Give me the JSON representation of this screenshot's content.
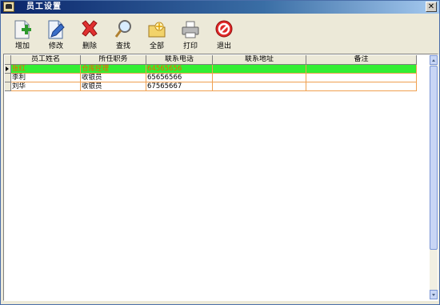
{
  "window": {
    "title": "员工设置",
    "close_label": "✕"
  },
  "toolbar": {
    "items": [
      {
        "label": "增加",
        "icon": "add-document-icon"
      },
      {
        "label": "修改",
        "icon": "edit-document-icon"
      },
      {
        "label": "删除",
        "icon": "delete-x-icon"
      },
      {
        "label": "查找",
        "icon": "magnifier-icon"
      },
      {
        "label": "全部",
        "icon": "folder-all-icon"
      },
      {
        "label": "打印",
        "icon": "printer-icon"
      },
      {
        "label": "退出",
        "icon": "exit-stop-icon"
      }
    ]
  },
  "grid": {
    "columns": [
      "员工姓名",
      "所任职务",
      "联系电话",
      "联系地址",
      "备注"
    ],
    "rows": [
      {
        "name": "张红",
        "role": "仓库经理",
        "phone": "64565656",
        "address": "",
        "note": ""
      },
      {
        "name": "李利",
        "role": "收银员",
        "phone": "65656566",
        "address": "",
        "note": ""
      },
      {
        "name": "刘华",
        "role": "收银员",
        "phone": "67565667",
        "address": "",
        "note": ""
      }
    ],
    "selected_row": 0
  },
  "colors": {
    "selected_row_bg": "#33ee33",
    "selected_row_text": "#ff5a00",
    "cell_border": "#f0a050"
  }
}
